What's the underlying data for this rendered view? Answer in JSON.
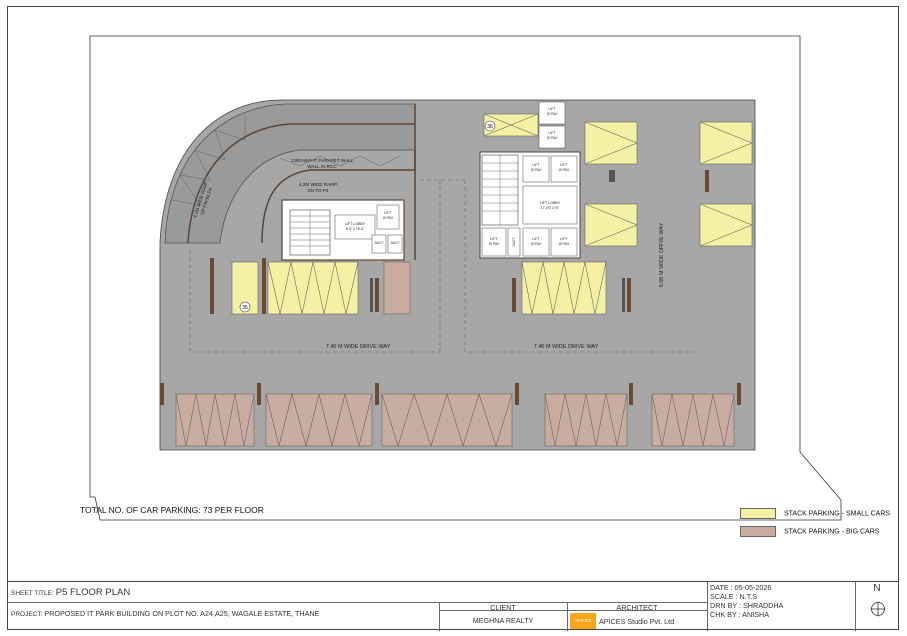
{
  "plan": {
    "labels": {
      "parapet": "1200 MM HT PARAPET WALL",
      "wall_rcc": "WALL IN RCC",
      "ramp_down": "4.2M WIDE RAMP",
      "ramp_down2": "DN TO P4",
      "ramp_up": "4.2M WIDE RAMP",
      "ramp_up2": "UP FROM P4",
      "drive_left": "7.40 M WIDE DRIVE WAY",
      "drive_right": "7.40 M WIDE DRIVE WAY",
      "drive_vertical": "6.00 M WIDE DRIVE WAY",
      "lift": "LIFT",
      "lift_cap": "20 PAX",
      "lift_lobby": "LIFT LOBBY",
      "lift_lobby_dim": "8'-6\" X 16'-6\"",
      "lift_lobby_dim2": "17'-6\"X 17'6\"",
      "duct": "DUCT",
      "badge_a": "35",
      "badge_b": "36"
    }
  },
  "total_parking": "TOTAL NO. OF CAR PARKING: 73 PER FLOOR",
  "legend": [
    {
      "label": "STACK PARKING - SMALL CARS",
      "color": "#f4f0a4"
    },
    {
      "label": "STACK PARKING - BIG CARS",
      "color": "#c8aca0"
    }
  ],
  "title_block": {
    "sheet_title_label": "SHEET TITLE:",
    "sheet_title": "P5 FLOOR PLAN",
    "project_label": "PROJECT:",
    "project": "PROPOSED IT PARK BUILDING ON PLOT NO. A24,A25, WAGALE ESTATE, THANE",
    "client_label": "CLIENT",
    "client": "MEGHNA REALTY",
    "architect_label": "ARCHITECT",
    "architect": "APICES Studio Pvt. Ltd",
    "logo_text": "APICES",
    "date": "DATE :  05-05-2026",
    "scale": "SCALE :  N.T.S",
    "drn": "DRN BY : SHRADDHA",
    "chk": "CHK BY :  ANISHA",
    "north": "N"
  },
  "colors": {
    "floor": "#a7a7a7",
    "small_car": "#f4f0a4",
    "big_car": "#c8aca0",
    "wall": "#6b4a34",
    "core": "#ffffff"
  }
}
